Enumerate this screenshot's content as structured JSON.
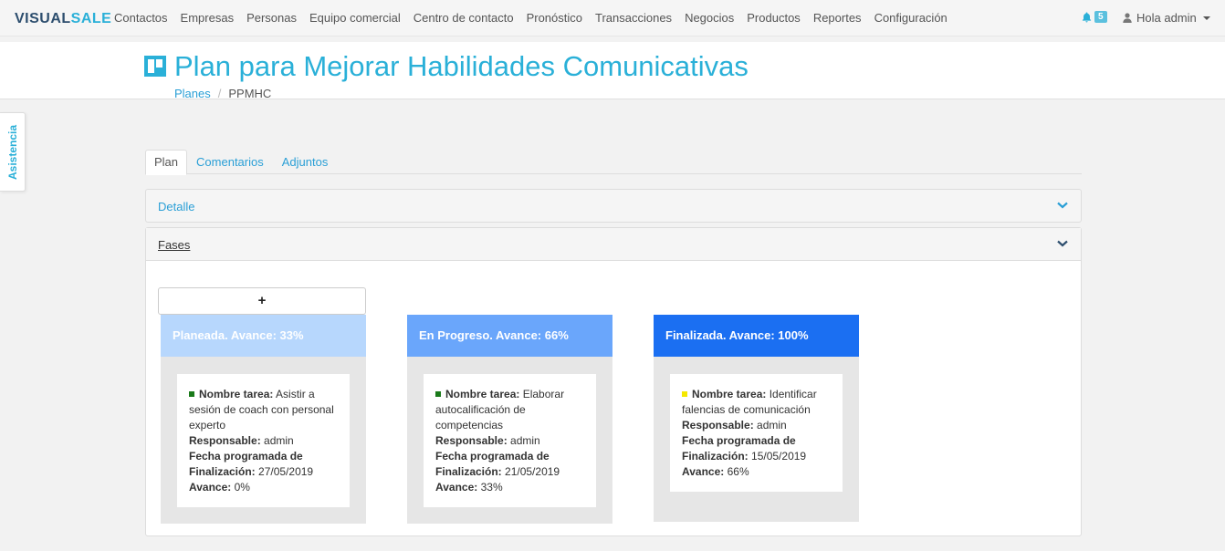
{
  "nav": {
    "logo_part1": "VISUAL",
    "logo_part2": "SALE",
    "menu": [
      "Contactos",
      "Empresas",
      "Personas",
      "Equipo comercial",
      "Centro de contacto",
      "Pronóstico",
      "Transacciones",
      "Negocios",
      "Productos",
      "Reportes",
      "Configuración"
    ],
    "notifications": "5",
    "user_label": "Hola admin"
  },
  "header": {
    "title": "Plan para Mejorar Habilidades Comunicativas",
    "breadcrumb": {
      "parent": "Planes",
      "separator": "/",
      "current": "PPMHC"
    }
  },
  "side_tab": "Asistencia",
  "tabs": [
    "Plan",
    "Comentarios",
    "Adjuntos"
  ],
  "panels": {
    "detalle": "Detalle",
    "fases": "Fases"
  },
  "add_button": "+",
  "columns": [
    {
      "title": "Planeada. Avance: 33%",
      "color": "#b7d7fd",
      "card": {
        "status_color": "#1a7a1a",
        "name_label": "Nombre tarea:",
        "name": "Asistir a sesión de coach con personal experto",
        "responsable_label": "Responsable:",
        "responsable": "admin",
        "fecha_label": "Fecha programada de Finalización:",
        "fecha": "27/05/2019",
        "avance_label": "Avance:",
        "avance": "0%"
      }
    },
    {
      "title": "En Progreso. Avance: 66%",
      "color": "#6aa6fb",
      "card": {
        "status_color": "#1a7a1a",
        "name_label": "Nombre tarea:",
        "name": "Elaborar autocalificación de competencias",
        "responsable_label": "Responsable:",
        "responsable": "admin",
        "fecha_label": "Fecha programada de Finalización:",
        "fecha": "21/05/2019",
        "avance_label": "Avance:",
        "avance": "33%"
      }
    },
    {
      "title": "Finalizada. Avance: 100%",
      "color": "#1b6ff2",
      "card": {
        "status_color": "#f5e800",
        "name_label": "Nombre tarea:",
        "name": "Identificar falencias de comunicación",
        "responsable_label": "Responsable:",
        "responsable": "admin",
        "fecha_label": "Fecha programada de Finalización:",
        "fecha": "15/05/2019",
        "avance_label": "Avance:",
        "avance": "66%"
      }
    }
  ]
}
